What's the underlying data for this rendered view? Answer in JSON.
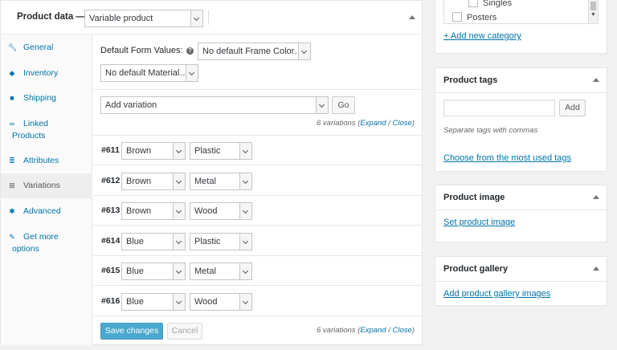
{
  "product_data": {
    "title": "Product data —",
    "type_select": "Variable product",
    "tabs": [
      {
        "icon": "wrench",
        "label": "General"
      },
      {
        "icon": "tag",
        "label": "Inventory"
      },
      {
        "icon": "truck",
        "label": "Shipping"
      },
      {
        "icon": "link",
        "label": "Linked Products"
      },
      {
        "icon": "list",
        "label": "Attributes"
      },
      {
        "icon": "grid",
        "label": "Variations"
      },
      {
        "icon": "gear",
        "label": "Advanced"
      },
      {
        "icon": "plugin",
        "label": "Get more options"
      }
    ],
    "active_tab": "Variations"
  },
  "variations": {
    "default_form_label": "Default Form Values:",
    "default_frame_select": "No default Frame Color…",
    "default_material_select": "No default Material…",
    "add_variation_select": "Add variation",
    "go_label": "Go",
    "count_text": "6 variations (",
    "expand_label": "Expand",
    "slash": " / ",
    "close_label": "Close",
    "close_paren": ")",
    "rows": [
      {
        "id": "#611",
        "color": "Brown",
        "material": "Plastic"
      },
      {
        "id": "#612",
        "color": "Brown",
        "material": "Metal"
      },
      {
        "id": "#613",
        "color": "Brown",
        "material": "Wood"
      },
      {
        "id": "#614",
        "color": "Blue",
        "material": "Plastic"
      },
      {
        "id": "#615",
        "color": "Blue",
        "material": "Metal"
      },
      {
        "id": "#616",
        "color": "Blue",
        "material": "Wood"
      }
    ],
    "save_label": "Save changes",
    "cancel_label": "Cancel"
  },
  "categories": {
    "items": [
      "Singles",
      "Posters"
    ],
    "add_link": "+ Add new category"
  },
  "product_tags": {
    "title": "Product tags",
    "add_label": "Add",
    "hint": "Separate tags with commas",
    "choose_link": "Choose from the most used tags"
  },
  "product_image": {
    "title": "Product image",
    "set_link": "Set product image"
  },
  "product_gallery": {
    "title": "Product gallery",
    "add_link": "Add product gallery images"
  },
  "colors": {
    "link": "#0073aa",
    "primary": "#0085ba",
    "heading": "#23282d"
  }
}
